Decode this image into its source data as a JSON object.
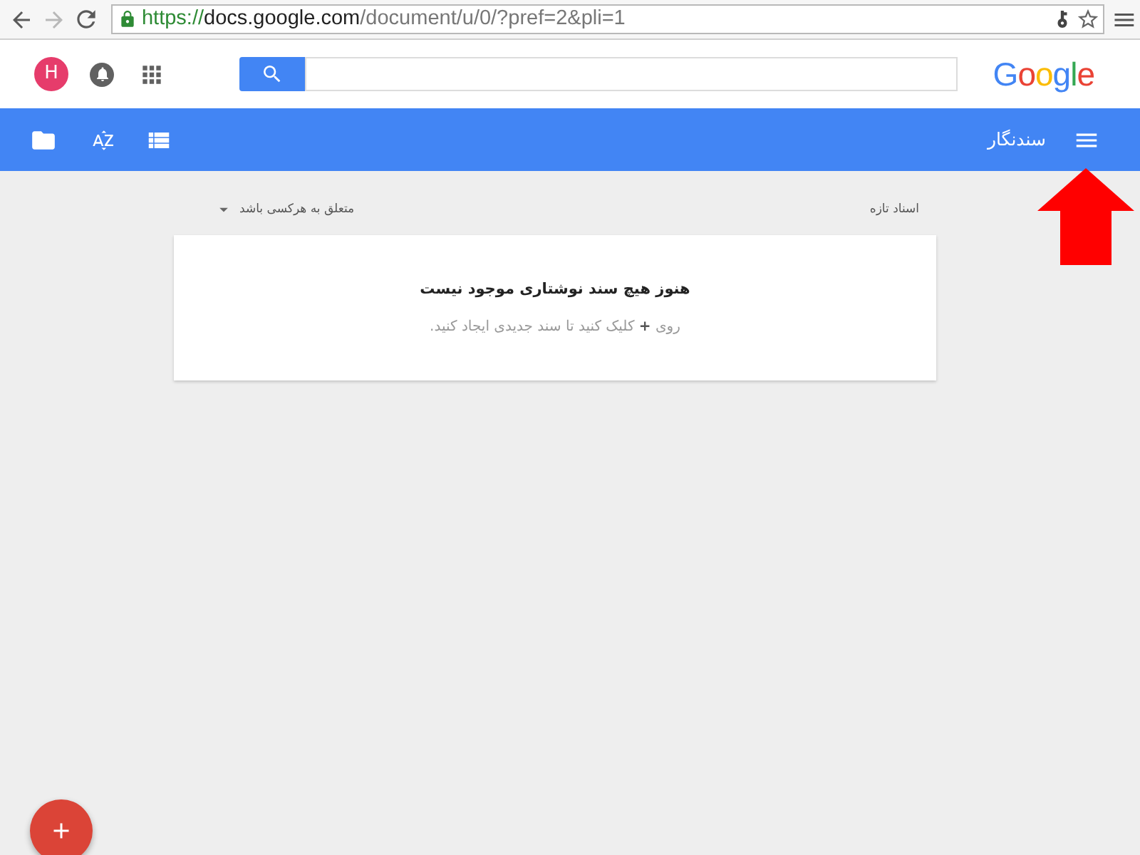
{
  "browser": {
    "nav": [
      {
        "kind": "back",
        "disabled": false
      },
      {
        "kind": "forward",
        "disabled": true
      },
      {
        "kind": "reload",
        "disabled": false
      }
    ],
    "url": {
      "scheme": "https://",
      "host": "docs.google.com",
      "path": "/document/u/0/?pref=2&pli=1"
    }
  },
  "header": {
    "avatar": "H",
    "logo": "Google"
  },
  "toolbar": {
    "title": "سندنگار"
  },
  "list": {
    "heading": "اسناد تازه",
    "owner_filter": "متعلق به هرکسی باشد"
  },
  "empty_state": {
    "title": "هنوز هیچ سند نوشتاری موجود نیست",
    "hint": "روی **+** کلیک کنید تا سند جدیدی ایجاد کنید."
  }
}
